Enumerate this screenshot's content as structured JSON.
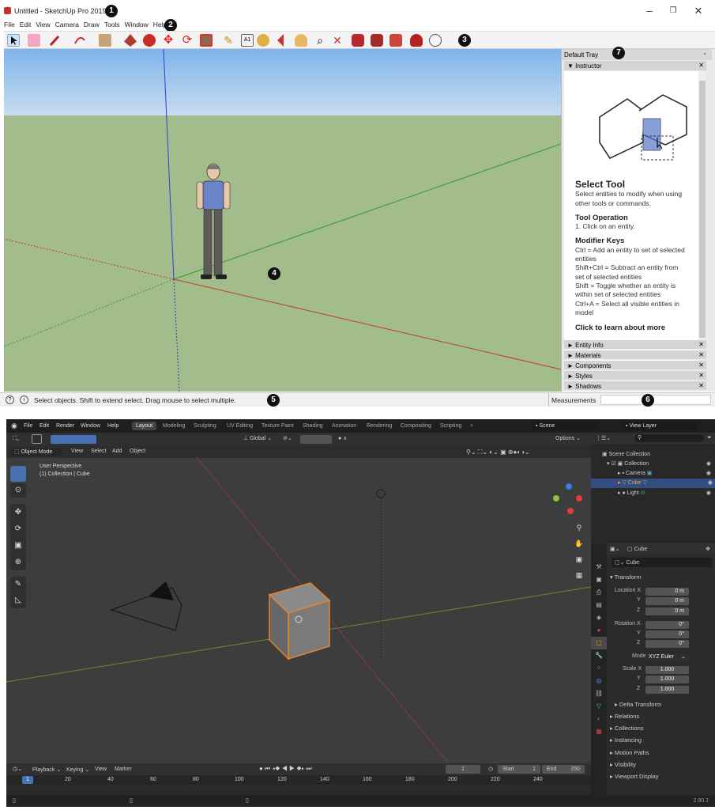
{
  "sketchup": {
    "window_title": "Untitled - SketchUp Pro 2019",
    "menu": [
      "File",
      "Edit",
      "View",
      "Camera",
      "Draw",
      "Tools",
      "Window",
      "Help"
    ],
    "callouts": [
      "1",
      "2",
      "3",
      "4",
      "5",
      "6",
      "7"
    ],
    "tray_title": "Default Tray",
    "instructor": {
      "header": "▼ Instructor",
      "title": "Select Tool",
      "desc": "Select entities to modify when using other tools or commands.",
      "op_title": "Tool Operation",
      "op_text": "1. Click on an entity.",
      "mod_title": "Modifier Keys",
      "mod_lines": [
        "Ctrl = Add an entity to set of selected entities",
        "Shift+Ctrl = Subtract an entity from set of selected entities",
        "Shift = Toggle whether an entity is within set of selected entities",
        "Ctrl+A = Select all visible entities in model"
      ],
      "link": "Click to learn about more"
    },
    "tray_panels": [
      "► Entity Info",
      "► Materials",
      "► Components",
      "► Styles",
      "► Shadows"
    ],
    "status_text": "Select objects. Shift to extend select. Drag mouse to select multiple.",
    "measurements_label": "Measurements"
  },
  "blender": {
    "menu": [
      "File",
      "Edit",
      "Render",
      "Window",
      "Help"
    ],
    "workspaces": [
      "Layout",
      "Modeling",
      "Sculpting",
      "UV Editing",
      "Texture Paint",
      "Shading",
      "Animation",
      "Rendering",
      "Compositing",
      "Scripting",
      "+"
    ],
    "scene": "Scene",
    "view_layer": "View Layer",
    "header2": {
      "orientation": "Global",
      "options": "Options ⌄"
    },
    "header3": {
      "mode": "Object Mode",
      "items": [
        "View",
        "Select",
        "Add",
        "Object"
      ]
    },
    "viewport_info": {
      "line1": "User Perspective",
      "line2": "(1) Collection | Cube"
    },
    "outliner": {
      "scene_collection": "Scene Collection",
      "collection": "Collection",
      "items": [
        "Camera",
        "Cube",
        "Light"
      ]
    },
    "props": {
      "object_label": "Cube",
      "object_name": "Cube",
      "transform": "Transform",
      "location_label": "Location X",
      "location": [
        "0 m",
        "0 m",
        "0 m"
      ],
      "rotation_label": "Rotation X",
      "rotation": [
        "0°",
        "0°",
        "0°"
      ],
      "mode_label": "Mode",
      "mode_value": "XYZ Euler",
      "scale_label": "Scale X",
      "scale": [
        "1.000",
        "1.000",
        "1.000"
      ],
      "axes": [
        "Y",
        "Z"
      ],
      "delta": "Delta Transform",
      "sections": [
        "Relations",
        "Collections",
        "Instancing",
        "Motion Paths",
        "Visibility",
        "Viewport Display"
      ]
    },
    "timeline": {
      "menu": [
        "Playback ⌄",
        "Keying ⌄",
        "View",
        "Marker"
      ],
      "current_frame": "1",
      "start_label": "Start",
      "start": "1",
      "end_label": "End",
      "end": "250",
      "ticks": [
        "1",
        "20",
        "40",
        "60",
        "80",
        "100",
        "120",
        "140",
        "160",
        "180",
        "200",
        "220",
        "240"
      ]
    },
    "version": "2.90.1"
  },
  "colors": {
    "su_ground": "#a3bc8c",
    "su_sky": "#7fb4ea",
    "bl_accent": "#e8822d",
    "bl_select": "#334d80"
  }
}
